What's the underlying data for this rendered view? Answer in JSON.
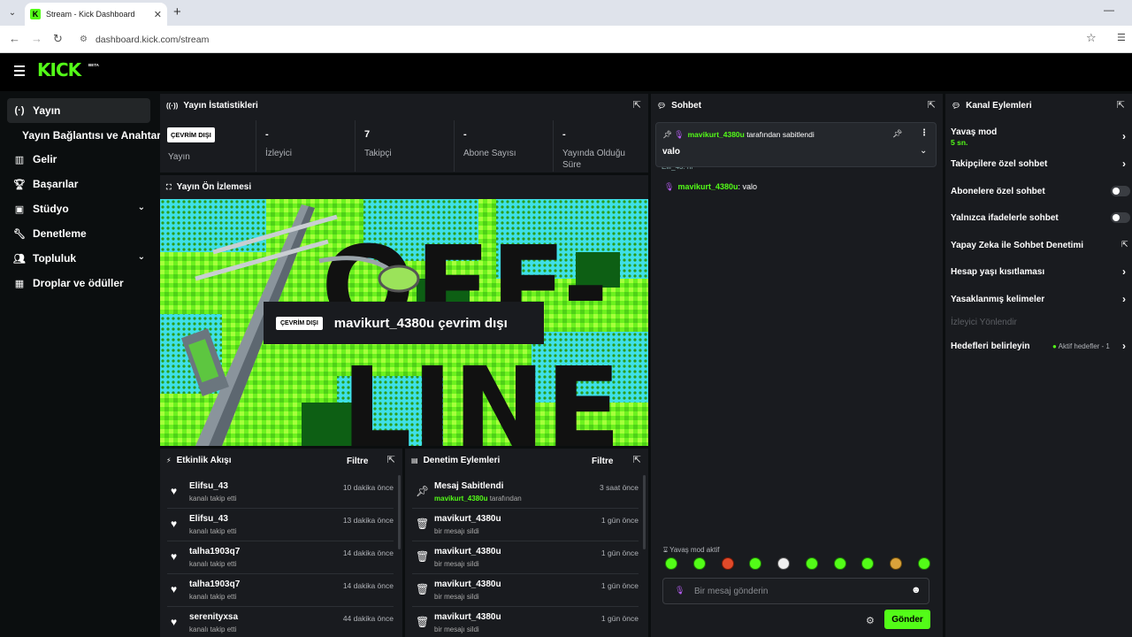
{
  "browser": {
    "tab_title": "Stream - Kick Dashboard",
    "url": "dashboard.kick.com/stream"
  },
  "app": {
    "logo": "KICK",
    "logo_badge": "BETA"
  },
  "sidebar": {
    "items": [
      {
        "label": "Yayın",
        "icon": "broadcast-icon"
      },
      {
        "label": "Yayın Bağlantısı ve Anahtarı"
      },
      {
        "label": "Gelir",
        "icon": "chart-icon"
      },
      {
        "label": "Başarılar",
        "icon": "trophy-icon"
      },
      {
        "label": "Stüdyo",
        "icon": "studio-icon"
      },
      {
        "label": "Denetleme",
        "icon": "wrench-icon"
      },
      {
        "label": "Topluluk",
        "icon": "users-icon"
      },
      {
        "label": "Droplar ve ödüller",
        "icon": "drops-icon"
      }
    ]
  },
  "stats": {
    "title": "Yayın İstatistikleri",
    "badge": "ÇEVRİM DIŞI",
    "stream_label": "Yayın",
    "viewers_value": "-",
    "viewers_label": "İzleyici",
    "followers_value": "7",
    "followers_label": "Takipçi",
    "subs_value": "-",
    "subs_label": "Abone Sayısı",
    "uptime_value": "-",
    "uptime_label_1": "Yayında Olduğu",
    "uptime_label_2": "Süre"
  },
  "preview": {
    "title": "Yayın Ön İzlemesi",
    "badge": "ÇEVRİM DIŞI",
    "offline_text": "mavikurt_4380u çevrim dışı",
    "art_text_1": "OFF-",
    "art_text_2": "LINE"
  },
  "activity": {
    "title": "Etkinlik Akışı",
    "filter": "Filtre",
    "rows": [
      {
        "name": "Elifsu_43",
        "sub": "kanalı takip etti",
        "time": "10 dakika önce"
      },
      {
        "name": "Elifsu_43",
        "sub": "kanalı takip etti",
        "time": "13 dakika önce"
      },
      {
        "name": "talha1903q7",
        "sub": "kanalı takip etti",
        "time": "14 dakika önce"
      },
      {
        "name": "talha1903q7",
        "sub": "kanalı takip etti",
        "time": "14 dakika önce"
      },
      {
        "name": "serenityxsa",
        "sub": "kanalı takip etti",
        "time": "44 dakika önce"
      }
    ]
  },
  "moderation": {
    "title": "Denetim Eylemleri",
    "filter": "Filtre",
    "rows": [
      {
        "name": "Mesaj Sabitlendi",
        "user": "mavikurt_4380u",
        "sub": " tarafından",
        "time": "3 saat önce"
      },
      {
        "name": "mavikurt_4380u",
        "sub": "bir mesajı sildi",
        "time": "1 gün önce"
      },
      {
        "name": "mavikurt_4380u",
        "sub": "bir mesajı sildi",
        "time": "1 gün önce"
      },
      {
        "name": "mavikurt_4380u",
        "sub": "bir mesajı sildi",
        "time": "1 gün önce"
      },
      {
        "name": "mavikurt_4380u",
        "sub": "bir mesajı sildi",
        "time": "1 gün önce"
      }
    ]
  },
  "chat": {
    "title": "Sohbet",
    "pinned_user": "mavikurt_4380u",
    "pinned_suffix": " tarafından sabitlendi",
    "pinned_message": "valo",
    "partial_line": "Elif_43: hi",
    "message_user": "mavikurt_4380u",
    "message_text": ": valo",
    "slow_mode_notice": "Yavaş mod aktif",
    "input_placeholder": "Bir mesaj gönderin",
    "send_label": "Gönder"
  },
  "channel_actions": {
    "title": "Kanal Eylemleri",
    "slow_mode": "Yavaş mod",
    "slow_mode_value": "5 sn.",
    "followers_only": "Takipçilere özel sohbet",
    "subscribers_only": "Abonelere özel sohbet",
    "emotes_only": "Yalnızca ifadelerle sohbet",
    "ai_moderation": "Yapay Zeka ile Sohbet Denetimi",
    "account_age": "Hesap yaşı kısıtlaması",
    "banned_words": "Yasaklanmış kelimeler",
    "viewer_redirect": "İzleyici Yönlendir",
    "goals": "Hedefleri belirleyin",
    "goals_status": "Aktif hedefler - 1"
  },
  "colors": {
    "accent": "#53fc18",
    "panel": "#191b1f",
    "background": "#0b0e0f"
  }
}
